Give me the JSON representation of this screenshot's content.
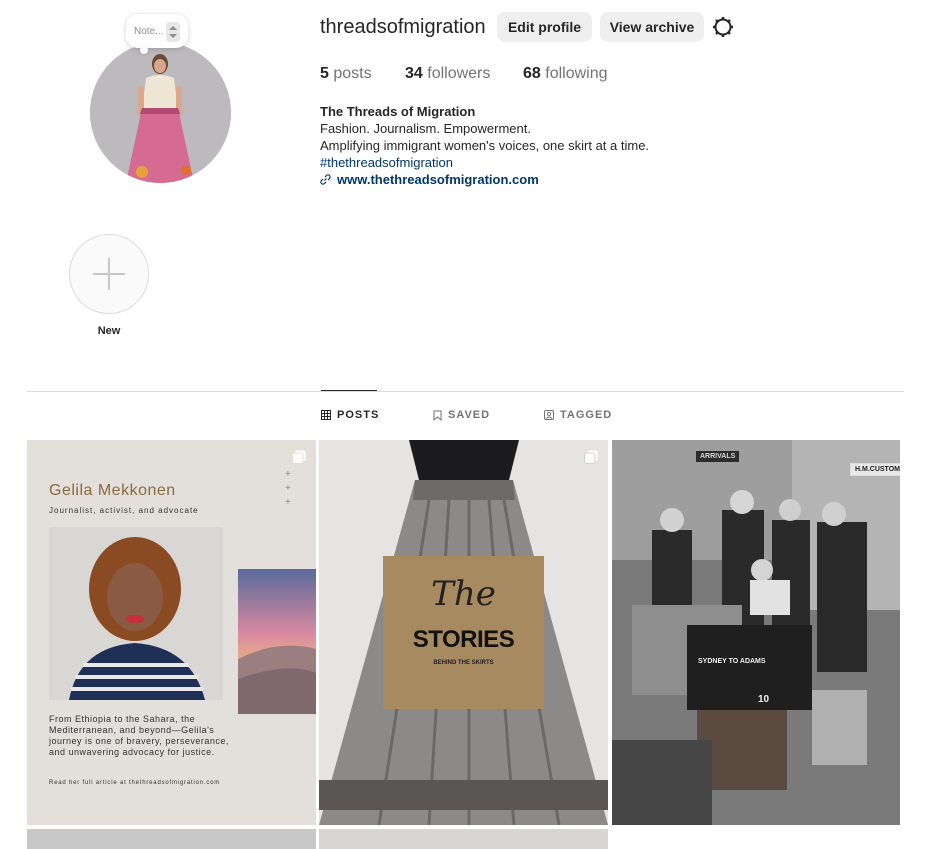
{
  "profile": {
    "username": "threadsofmigration",
    "note_placeholder": "Note...",
    "edit_profile_label": "Edit profile",
    "view_archive_label": "View archive",
    "stats": {
      "posts_count": "5",
      "posts_label": "posts",
      "followers_count": "34",
      "followers_label": "followers",
      "following_count": "68",
      "following_label": "following"
    },
    "bio": {
      "name": "The Threads of Migration",
      "line1": "Fashion. Journalism. Empowerment.",
      "line2": "Amplifying immigrant women's voices, one skirt at a time.",
      "hashtag": "#thethreadsofmigration",
      "website": "www.thethreadsofmigration.com"
    }
  },
  "highlights": {
    "new_label": "New"
  },
  "tabs": [
    {
      "label": "POSTS",
      "icon": "grid-icon",
      "active": true
    },
    {
      "label": "SAVED",
      "icon": "bookmark-icon",
      "active": false
    },
    {
      "label": "TAGGED",
      "icon": "tagged-icon",
      "active": false
    }
  ],
  "posts": [
    {
      "title": "Gelila Mekkonen",
      "subtitle": "Journalist, activist, and advocate",
      "body": "From Ethiopia to the Sahara, the Mediterranean, and beyond—Gelila's journey is one of bravery, perseverance, and unwavering advocacy for justice.",
      "read_more": "Read her full article at thethreadsofmigration.com",
      "multi": true
    },
    {
      "script": "The",
      "headline": "STORIES",
      "tagline": "BEHIND THE SKIRTS",
      "multi": true
    },
    {
      "signs": [
        "ARRIVALS",
        "H.M.CUSTOMS",
        "SYDNEY TO ADAMS",
        "10"
      ],
      "multi": false
    }
  ],
  "colors": {
    "accent_link": "#00376b",
    "button_bg": "#efefef",
    "divider": "#dbdbdb"
  }
}
